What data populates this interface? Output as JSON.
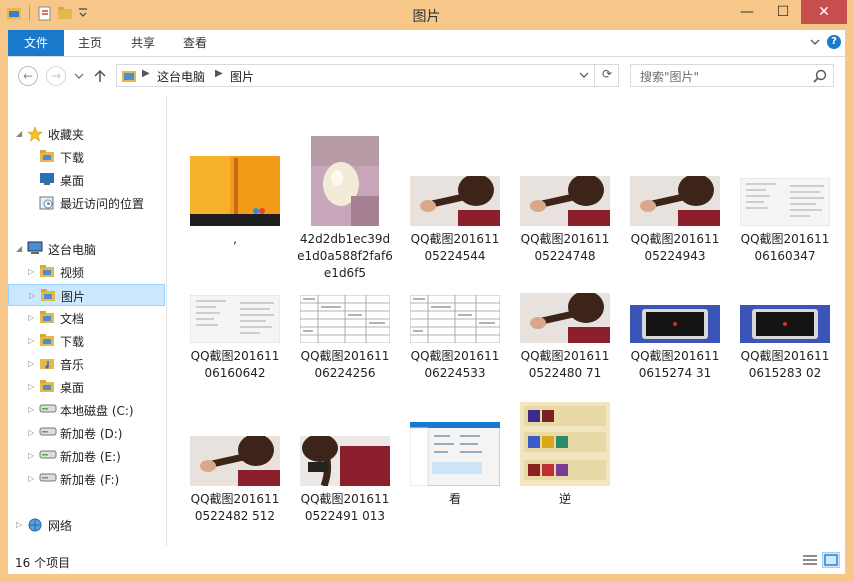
{
  "window": {
    "title": "图片",
    "controls": {
      "minimize": "—",
      "maximize": "☐",
      "close": "✕"
    }
  },
  "ribbon": {
    "tabs": [
      {
        "label": "文件"
      },
      {
        "label": "主页"
      },
      {
        "label": "共享"
      },
      {
        "label": "查看"
      }
    ]
  },
  "address": {
    "crumbs": [
      "这台电脑",
      "图片"
    ],
    "search_placeholder": "搜索\"图片\""
  },
  "sidebar": {
    "items": [
      {
        "label": "收藏夹",
        "icon": "star-icon"
      },
      {
        "label": "下载",
        "icon": "download-folder-icon"
      },
      {
        "label": "桌面",
        "icon": "desktop-icon"
      },
      {
        "label": "最近访问的位置",
        "icon": "recent-places-icon"
      },
      {
        "label": "这台电脑",
        "icon": "computer-icon"
      },
      {
        "label": "视频",
        "icon": "video-folder-icon"
      },
      {
        "label": "图片",
        "icon": "pictures-folder-icon"
      },
      {
        "label": "文档",
        "icon": "documents-folder-icon"
      },
      {
        "label": "下载",
        "icon": "download-folder-icon"
      },
      {
        "label": "音乐",
        "icon": "music-folder-icon"
      },
      {
        "label": "桌面",
        "icon": "desktop-folder-icon"
      },
      {
        "label": "本地磁盘 (C:)",
        "icon": "drive-icon"
      },
      {
        "label": "新加卷 (D:)",
        "icon": "drive-icon"
      },
      {
        "label": "新加卷 (E:)",
        "icon": "drive-icon"
      },
      {
        "label": "新加卷 (F:)",
        "icon": "drive-icon"
      },
      {
        "label": "网络",
        "icon": "network-icon"
      }
    ],
    "selected": "图片"
  },
  "files": [
    {
      "name": ",",
      "thumb": "orange-screen"
    },
    {
      "name": "42d2db1ec39de1d0a588f2faf6e1d6f5",
      "thumb": "egg"
    },
    {
      "name": "QQ截图20161105224544",
      "thumb": "hair"
    },
    {
      "name": "QQ截图20161105224748",
      "thumb": "hair"
    },
    {
      "name": "QQ截图20161105224943",
      "thumb": "hair"
    },
    {
      "name": "QQ截图20161106160347",
      "thumb": "doc"
    },
    {
      "name": "QQ截图20161106160642",
      "thumb": "doc"
    },
    {
      "name": "QQ截图20161106224256",
      "thumb": "table"
    },
    {
      "name": "QQ截图20161106224533",
      "thumb": "table"
    },
    {
      "name": "QQ截图2016110522480 71",
      "thumb": "hair"
    },
    {
      "name": "QQ截图2016110615274 31",
      "thumb": "phone"
    },
    {
      "name": "QQ截图2016110615283 02",
      "thumb": "phone"
    },
    {
      "name": "QQ截图2016110522482 512",
      "thumb": "hair"
    },
    {
      "name": "QQ截图2016110522491 013",
      "thumb": "hair2"
    },
    {
      "name": "看",
      "thumb": "window"
    },
    {
      "name": "逆",
      "thumb": "game"
    }
  ],
  "status": {
    "count": "16 个项目"
  },
  "colors": {
    "accent": "#1979ca",
    "frame": "#f6c788",
    "selection": "#cce8ff",
    "close": "#c7504f"
  }
}
